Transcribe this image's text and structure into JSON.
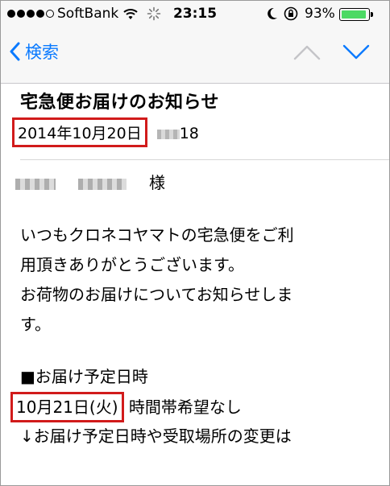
{
  "status_bar": {
    "carrier": "SoftBank",
    "signal_bars": 4,
    "time": "23:15",
    "battery_percent": "93%",
    "battery_level": 0.93,
    "battery_color": "#4cd964"
  },
  "nav": {
    "back_label": "検索",
    "accent": "#0a7aff",
    "up_icon": "chevron-up-icon",
    "down_icon": "chevron-down-icon"
  },
  "email": {
    "subject": "宅急便お届けのお知らせ",
    "date": "2014年10月20日",
    "date_suffix": "18",
    "highlight_color": "#d11b1b",
    "body": {
      "salutation": "様",
      "para1_line1": "いつもクロネコヤマトの宅急便をご利",
      "para1_line2": "用頂きありがとうございます。",
      "para1_line3": "お荷物のお届けについてお知らせしま",
      "para1_line4": "す。",
      "section_heading": "■お届け予定日時",
      "delivery_date": "10月21日(火)",
      "time_slot": "時間帯希望なし",
      "change_line": "↓お届け予定日時や受取場所の変更は"
    }
  }
}
